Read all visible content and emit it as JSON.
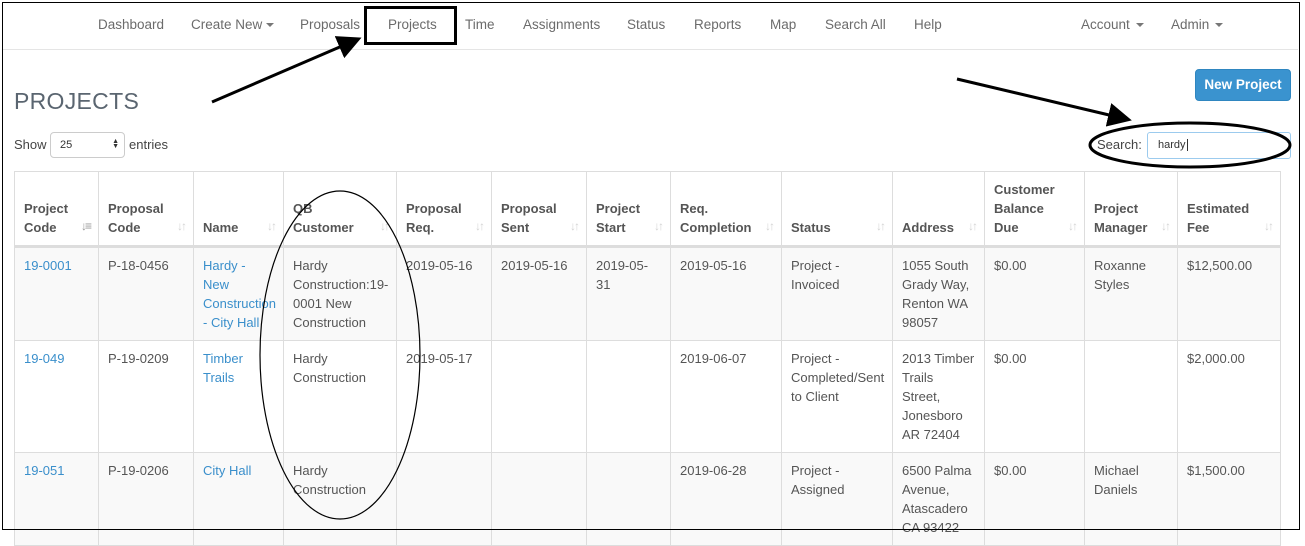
{
  "nav": {
    "items": [
      {
        "label": "Dashboard",
        "dropdown": false
      },
      {
        "label": "Create New",
        "dropdown": true
      },
      {
        "label": "Proposals",
        "dropdown": false
      },
      {
        "label": "Projects",
        "dropdown": false
      },
      {
        "label": "Time",
        "dropdown": false
      },
      {
        "label": "Assignments",
        "dropdown": false
      },
      {
        "label": "Status",
        "dropdown": false
      },
      {
        "label": "Reports",
        "dropdown": false
      },
      {
        "label": "Map",
        "dropdown": false
      },
      {
        "label": "Search All",
        "dropdown": false
      },
      {
        "label": "Help",
        "dropdown": false
      }
    ],
    "right": [
      {
        "label": "Account",
        "dropdown": true
      },
      {
        "label": "Admin",
        "dropdown": true
      }
    ],
    "highlighted": "Projects"
  },
  "page": {
    "title": "PROJECTS",
    "new_button": "New Project",
    "show_label": "Show",
    "entries_label": "entries",
    "page_length": "25",
    "search_label": "Search:",
    "search_value": "hardy"
  },
  "table": {
    "columns": [
      {
        "line1": "Project",
        "line2": "Code",
        "line3": "",
        "sorted": true
      },
      {
        "line1": "Proposal",
        "line2": "Code",
        "line3": "",
        "sorted": false
      },
      {
        "line1": "",
        "line2": "Name",
        "line3": "",
        "sorted": false
      },
      {
        "line1": "QB",
        "line2": "Customer",
        "line3": "",
        "sorted": false
      },
      {
        "line1": "Proposal",
        "line2": "Req.",
        "line3": "",
        "sorted": false
      },
      {
        "line1": "Proposal",
        "line2": "Sent",
        "line3": "",
        "sorted": false
      },
      {
        "line1": "Project",
        "line2": "Start",
        "line3": "",
        "sorted": false
      },
      {
        "line1": "Req.",
        "line2": "Completion",
        "line3": "",
        "sorted": false
      },
      {
        "line1": "",
        "line2": "Status",
        "line3": "",
        "sorted": false
      },
      {
        "line1": "",
        "line2": "Address",
        "line3": "",
        "sorted": false
      },
      {
        "line1": "Customer",
        "line2": "Balance",
        "line3": "Due",
        "sorted": false
      },
      {
        "line1": "Project",
        "line2": "Manager",
        "line3": "",
        "sorted": false
      },
      {
        "line1": "Estimated",
        "line2": "Fee",
        "line3": "",
        "sorted": false
      }
    ],
    "rows": [
      {
        "project_code": "19-0001",
        "proposal_code": "P-18-0456",
        "name": "Hardy - New Construction - City Hall",
        "qb_customer": "Hardy Construction:19-0001 New Construction",
        "proposal_req": "2019-05-16",
        "proposal_sent": "2019-05-16",
        "project_start": "2019-05-31",
        "req_completion": "2019-05-16",
        "status": "Project - Invoiced",
        "address": "1055 South Grady Way, Renton WA 98057",
        "balance_due": "$0.00",
        "project_manager": "Roxanne Styles",
        "estimated_fee": "$12,500.00"
      },
      {
        "project_code": "19-049",
        "proposal_code": "P-19-0209",
        "name": "Timber Trails",
        "qb_customer": "Hardy Construction",
        "proposal_req": "2019-05-17",
        "proposal_sent": "",
        "project_start": "",
        "req_completion": "2019-06-07",
        "status": "Project - Completed/Sent to Client",
        "address": "2013 Timber Trails Street, Jonesboro AR 72404",
        "balance_due": "$0.00",
        "project_manager": "",
        "estimated_fee": "$2,000.00"
      },
      {
        "project_code": "19-051",
        "proposal_code": "P-19-0206",
        "name": "City Hall",
        "qb_customer": "Hardy Construction",
        "proposal_req": "",
        "proposal_sent": "",
        "project_start": "",
        "req_completion": "2019-06-28",
        "status": "Project - Assigned",
        "address": "6500 Palma Avenue, Atascadero CA 93422",
        "balance_due": "$0.00",
        "project_manager": "Michael Daniels",
        "estimated_fee": "$1,500.00"
      }
    ]
  },
  "colors": {
    "link": "#3a8fcb",
    "primary_button": "#3a93cf",
    "title": "#5a6570"
  }
}
